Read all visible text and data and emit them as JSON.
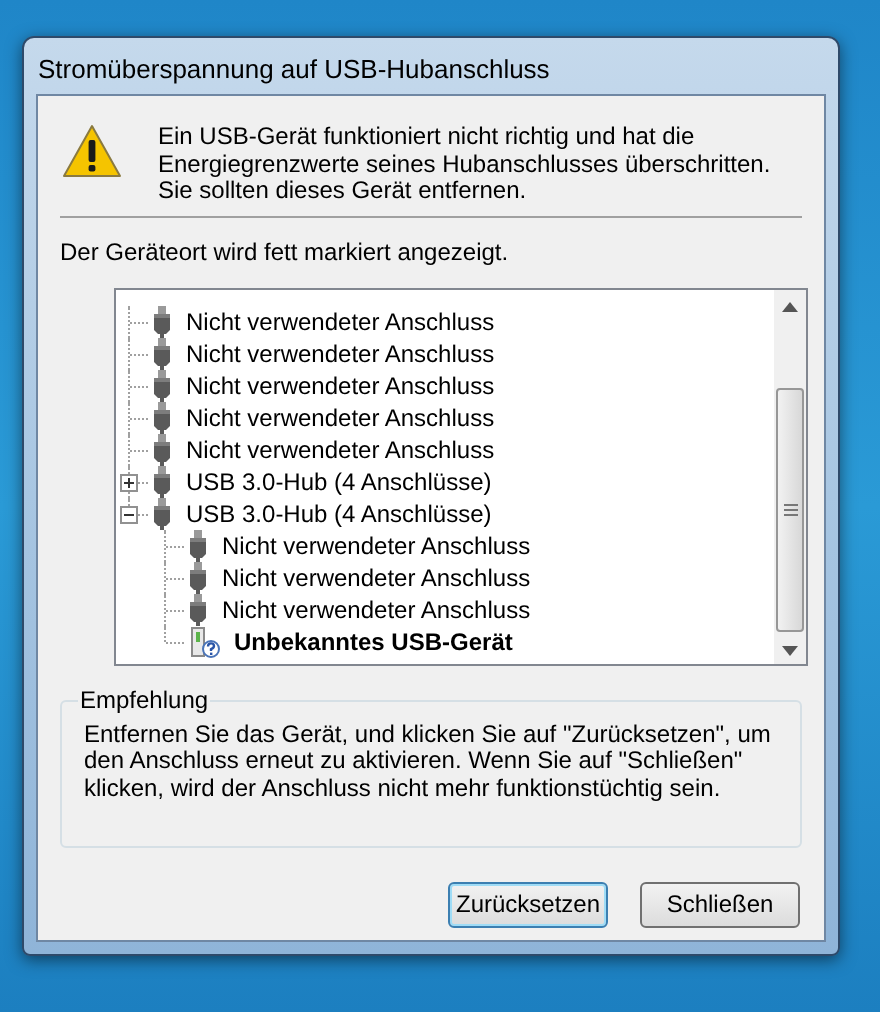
{
  "window": {
    "title": "Stromüberspannung auf USB-Hubanschluss"
  },
  "message": "Ein USB-Gerät funktioniert nicht richtig und hat die Energiegrenzwerte seines Hubanschlusses überschritten. Sie sollten dieses Gerät entfernen.",
  "location_note": "Der Geräteort wird fett markiert angezeigt.",
  "tree": [
    {
      "kind": "port",
      "label": "Nicht verwendeter Anschluss",
      "bold": false
    },
    {
      "kind": "port",
      "label": "Nicht verwendeter Anschluss",
      "bold": false
    },
    {
      "kind": "port",
      "label": "Nicht verwendeter Anschluss",
      "bold": false
    },
    {
      "kind": "port",
      "label": "Nicht verwendeter Anschluss",
      "bold": false
    },
    {
      "kind": "port",
      "label": "Nicht verwendeter Anschluss",
      "bold": false
    },
    {
      "kind": "hub",
      "label": "USB 3.0-Hub (4 Anschlüsse)",
      "bold": false,
      "expanded": false
    },
    {
      "kind": "hub",
      "label": "USB 3.0-Hub (4 Anschlüsse)",
      "bold": false,
      "expanded": true,
      "children": [
        {
          "kind": "port",
          "label": "Nicht verwendeter Anschluss",
          "bold": false
        },
        {
          "kind": "port",
          "label": "Nicht verwendeter Anschluss",
          "bold": false
        },
        {
          "kind": "port",
          "label": "Nicht verwendeter Anschluss",
          "bold": false
        },
        {
          "kind": "unknown",
          "label": "Unbekanntes USB-Gerät",
          "bold": true
        }
      ]
    }
  ],
  "recommendation": {
    "title": "Empfehlung",
    "text": "Entfernen Sie das Gerät, und klicken Sie auf \"Zurücksetzen\", um den Anschluss erneut zu aktivieren. Wenn Sie auf \"Schließen\" klicken, wird der Anschluss nicht mehr funktionstüchtig sein."
  },
  "buttons": [
    {
      "label": "Zurücksetzen",
      "default": true
    },
    {
      "label": "Schließen",
      "default": false
    }
  ]
}
